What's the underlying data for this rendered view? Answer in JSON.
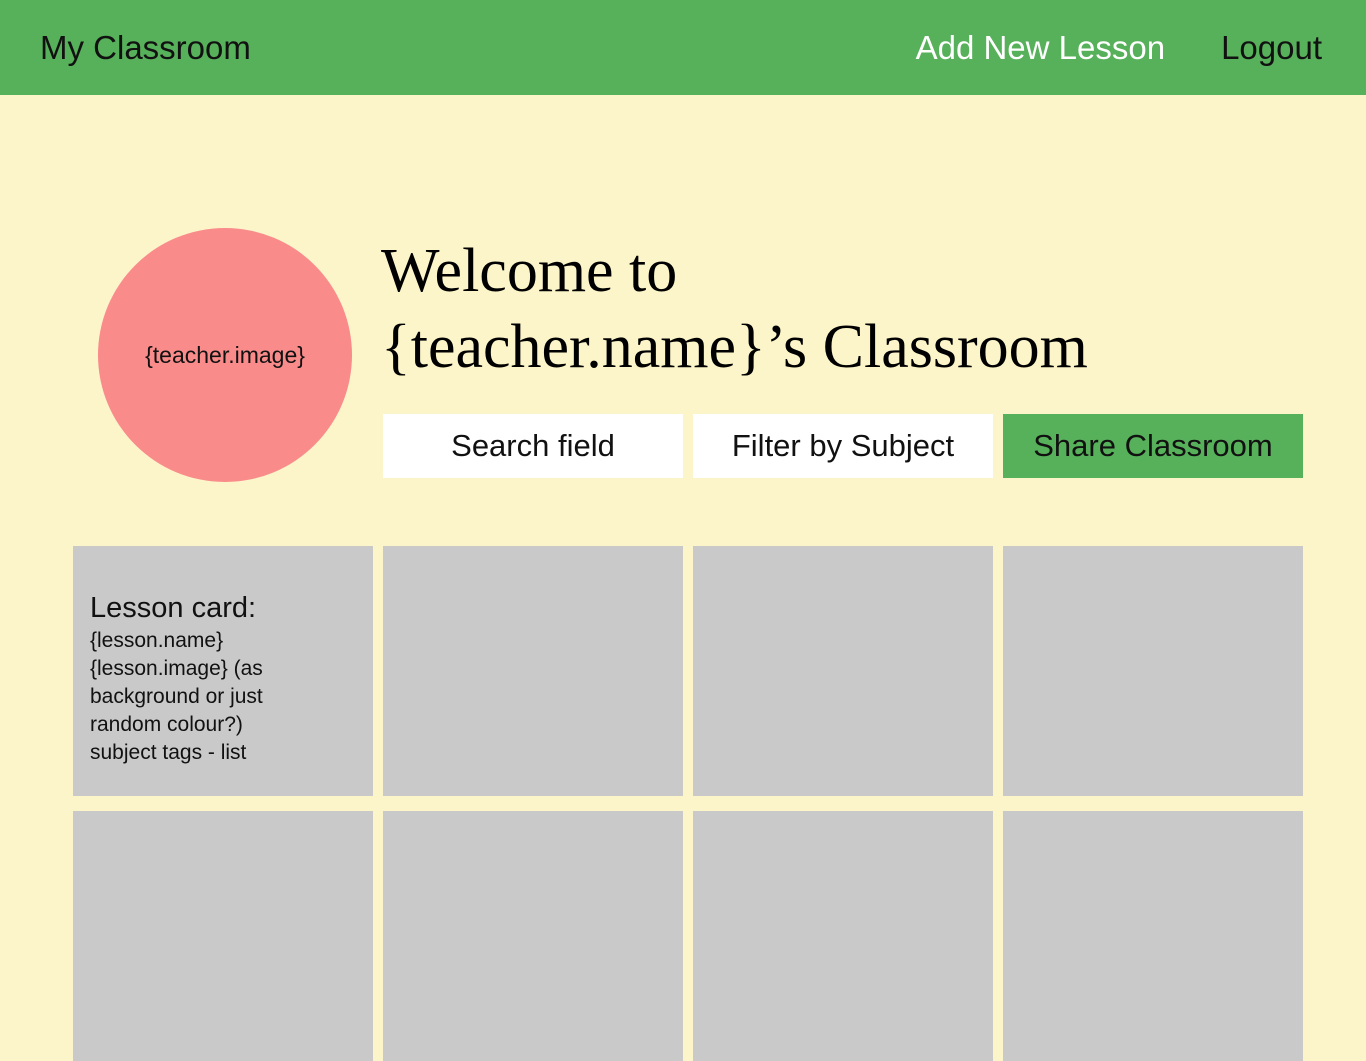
{
  "colors": {
    "page_background": "#FCF5C9",
    "navbar_green": "#57B05A",
    "avatar_pink": "#F98B8B",
    "card_grey": "#C9C9C9",
    "field_white": "#FFFFFF",
    "text_black": "#111111",
    "nav_add_link_white": "#FFFFFF"
  },
  "navbar": {
    "brand": "My Classroom",
    "links": [
      {
        "label": "Add New Lesson",
        "name": "add-new-lesson"
      },
      {
        "label": "Logout",
        "name": "logout"
      }
    ]
  },
  "hero": {
    "avatar_placeholder": "{teacher.image}",
    "welcome_line_1": "Welcome to",
    "welcome_line_2": "{teacher.name}’s Classroom"
  },
  "toolbar": {
    "search_label": "Search field",
    "filter_label": "Filter by Subject",
    "share_label": "Share Classroom"
  },
  "lesson_grid": {
    "annotated_card": {
      "heading": "Lesson card:",
      "notes": [
        "{lesson.name}",
        "{lesson.image} (as",
        "background or just",
        "random colour?)",
        "subject tags - list"
      ]
    },
    "columns": 4,
    "rows_visible": 2,
    "placeholder_card_count": 7
  }
}
